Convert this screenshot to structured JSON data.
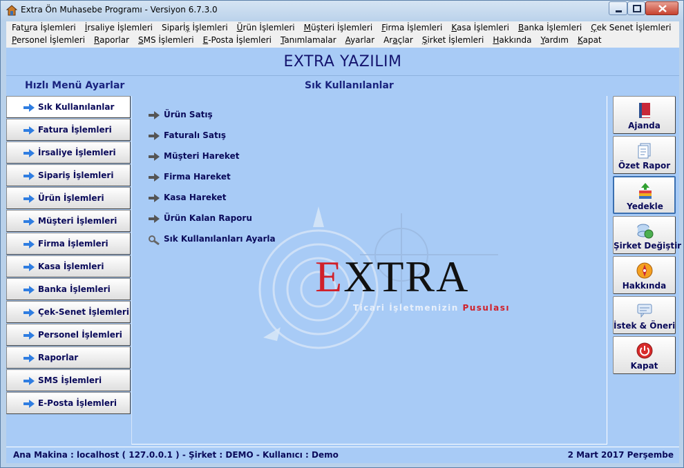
{
  "window": {
    "title": "Extra Ön Muhasebe Programı - Versiyon 6.7.3.0",
    "icon": "house-icon"
  },
  "menubar": {
    "row1": [
      {
        "pre": "Fat",
        "u": "u",
        "post": "ra İşlemleri"
      },
      {
        "pre": "",
        "u": "İ",
        "post": "rsaliye İşlemleri"
      },
      {
        "pre": "Siparİ",
        "u": "ş",
        "post": " İşlemleri"
      },
      {
        "pre": "",
        "u": "Ü",
        "post": "rün İşlemleri"
      },
      {
        "pre": "",
        "u": "M",
        "post": "üşteri İşlemleri"
      },
      {
        "pre": "",
        "u": "F",
        "post": "irma İşlemleri"
      },
      {
        "pre": "",
        "u": "K",
        "post": "asa İşlemleri"
      },
      {
        "pre": "",
        "u": "B",
        "post": "anka İşlemleri"
      },
      {
        "pre": "",
        "u": "Ç",
        "post": "ek Senet İşlemleri"
      }
    ],
    "row2": [
      {
        "pre": "",
        "u": "P",
        "post": "ersonel İşlemleri"
      },
      {
        "pre": "",
        "u": "R",
        "post": "aporlar"
      },
      {
        "pre": "",
        "u": "S",
        "post": "MS İşlemleri"
      },
      {
        "pre": "",
        "u": "E",
        "post": "-Posta İşlemleri"
      },
      {
        "pre": "",
        "u": "T",
        "post": "anımlamalar"
      },
      {
        "pre": "",
        "u": "A",
        "post": "yarlar"
      },
      {
        "pre": "Ar",
        "u": "a",
        "post": "çlar"
      },
      {
        "pre": "",
        "u": "Ş",
        "post": "irket İşlemleri"
      },
      {
        "pre": "",
        "u": "H",
        "post": "akkında"
      },
      {
        "pre": "",
        "u": "Y",
        "post": "ardım"
      },
      {
        "pre": "",
        "u": "K",
        "post": "apat"
      }
    ]
  },
  "main": {
    "brand_title": "EXTRA YAZILIM",
    "left_header": "Hızlı Menü Ayarlar",
    "center_header": "Sık Kullanılanlar"
  },
  "leftnav": {
    "items": [
      {
        "label": "Sık Kullanılanlar",
        "active": true
      },
      {
        "label": "Fatura İşlemleri"
      },
      {
        "label": "İrsaliye İşlemleri"
      },
      {
        "label": "Sipariş İşlemleri"
      },
      {
        "label": "Ürün İşlemleri"
      },
      {
        "label": "Müşteri İşlemleri"
      },
      {
        "label": "Firma İşlemleri"
      },
      {
        "label": "Kasa İşlemleri"
      },
      {
        "label": "Banka İşlemleri"
      },
      {
        "label": "Çek-Senet İşlemleri"
      },
      {
        "label": "Personel İşlemleri"
      },
      {
        "label": "Raporlar"
      },
      {
        "label": "SMS İşlemleri"
      },
      {
        "label": "E-Posta İşlemleri"
      }
    ]
  },
  "quick": {
    "items": [
      {
        "label": "Ürün Satış",
        "icon": "arrow-right-icon"
      },
      {
        "label": "Faturalı Satış",
        "icon": "arrow-right-icon"
      },
      {
        "label": "Müşteri Hareket",
        "icon": "arrow-right-icon"
      },
      {
        "label": "Firma Hareket",
        "icon": "arrow-right-icon"
      },
      {
        "label": "Kasa Hareket",
        "icon": "arrow-right-icon"
      },
      {
        "label": "Ürün Kalan Raporu",
        "icon": "arrow-right-icon"
      },
      {
        "label": "Sık Kullanılanları Ayarla",
        "icon": "wrench-icon"
      }
    ]
  },
  "logo": {
    "word_red": "E",
    "word_rest": "XTRA",
    "tagline": "Ticari İşletmenizin",
    "tagline_red": "Pusulası"
  },
  "rightnav": {
    "items": [
      {
        "label": "Ajanda",
        "icon": "book-icon"
      },
      {
        "label": "Özet Rapor",
        "icon": "report-icon"
      },
      {
        "label": "Yedekle",
        "icon": "backup-icon",
        "highlight": true
      },
      {
        "label": "Şirket Değiştir",
        "icon": "database-icon"
      },
      {
        "label": "Hakkında",
        "icon": "compass-icon"
      },
      {
        "label": "İstek & Öneri",
        "icon": "message-icon"
      },
      {
        "label": "Kapat",
        "icon": "power-icon"
      }
    ]
  },
  "status": {
    "left": "Ana Makina : localhost ( 127.0.0.1 ) - Şirket : DEMO   -  Kullanıcı : Demo",
    "right": "2 Mart 2017 Perşembe"
  },
  "colors": {
    "accent_blue": "#1a237e",
    "logo_red": "#d0202a",
    "background": "#a8cbf6"
  }
}
